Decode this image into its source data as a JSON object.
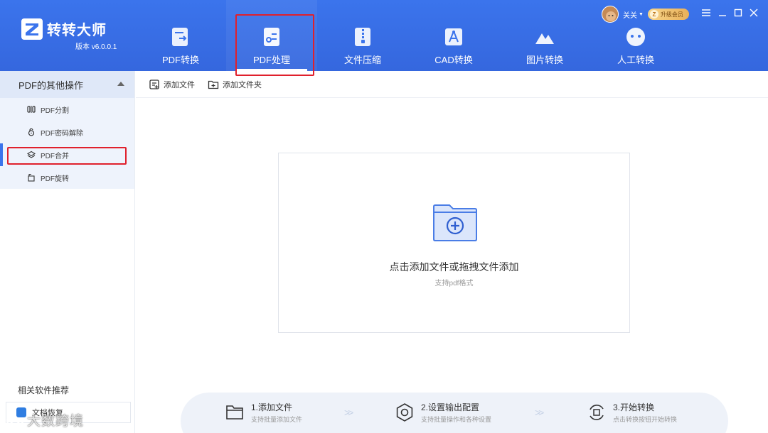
{
  "app": {
    "name": "转转大师",
    "version": "版本 v6.0.0.1",
    "brand_color": "#3b74ec"
  },
  "nav": {
    "items": [
      {
        "label": "PDF转换",
        "icon": "pdf-convert-icon"
      },
      {
        "label": "PDF处理",
        "icon": "pdf-process-icon",
        "active": true
      },
      {
        "label": "文件压缩",
        "icon": "zip-icon"
      },
      {
        "label": "CAD转换",
        "icon": "cad-icon"
      },
      {
        "label": "图片转换",
        "icon": "image-icon"
      },
      {
        "label": "人工转换",
        "icon": "chat-bot-icon"
      }
    ]
  },
  "user": {
    "name": "关关",
    "vip_label": "升级会员",
    "vip_badge": "Z"
  },
  "sidebar": {
    "section_title": "PDF的其他操作",
    "items": [
      {
        "label": "PDF分割",
        "icon": "split-icon"
      },
      {
        "label": "PDF密码解除",
        "icon": "unlock-icon"
      },
      {
        "label": "PDF合并",
        "icon": "layers-icon",
        "active": true
      },
      {
        "label": "PDF旋转",
        "icon": "rotate-icon"
      }
    ],
    "recommend_title": "相关软件推荐",
    "recommend_item": "文档恢复"
  },
  "toolbar": {
    "add_file": "添加文件",
    "add_folder": "添加文件夹"
  },
  "dropzone": {
    "title": "点击添加文件或拖拽文件添加",
    "subtitle": "支持pdf格式"
  },
  "steps": [
    {
      "title": "1.添加文件",
      "sub": "支持批量添加文件"
    },
    {
      "title": "2.设置输出配置",
      "sub": "支持批量操作和各种设置"
    },
    {
      "title": "3.开始转换",
      "sub": "点击转换按钮开始转换"
    }
  ],
  "watermark": "大数跨境",
  "highlight_color": "#e0202c"
}
